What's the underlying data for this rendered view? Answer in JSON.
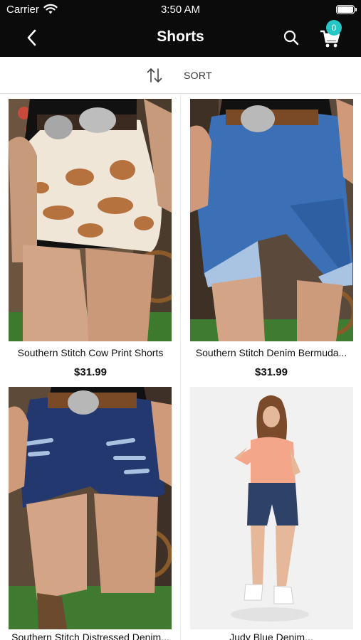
{
  "status_bar": {
    "carrier": "Carrier",
    "time": "3:50 AM"
  },
  "nav": {
    "title": "Shorts",
    "cart_count": "0"
  },
  "sort": {
    "label": "SORT"
  },
  "products": [
    {
      "name": "Southern Stitch Cow Print Shorts",
      "price": "$31.99",
      "image": "cow-print-shorts-photo"
    },
    {
      "name": "Southern Stitch Denim Bermuda...",
      "price": "$31.99",
      "image": "denim-bermuda-shorts-photo"
    },
    {
      "name": "Southern Stitch Distressed Denim...",
      "price": "",
      "image": "distressed-denim-shorts-photo"
    },
    {
      "name": "Judy Blue Denim...",
      "price": "",
      "image": "judy-blue-denim-shorts-photo"
    }
  ],
  "colors": {
    "header_bg": "#0b0b0b",
    "badge": "#27c6c6"
  }
}
